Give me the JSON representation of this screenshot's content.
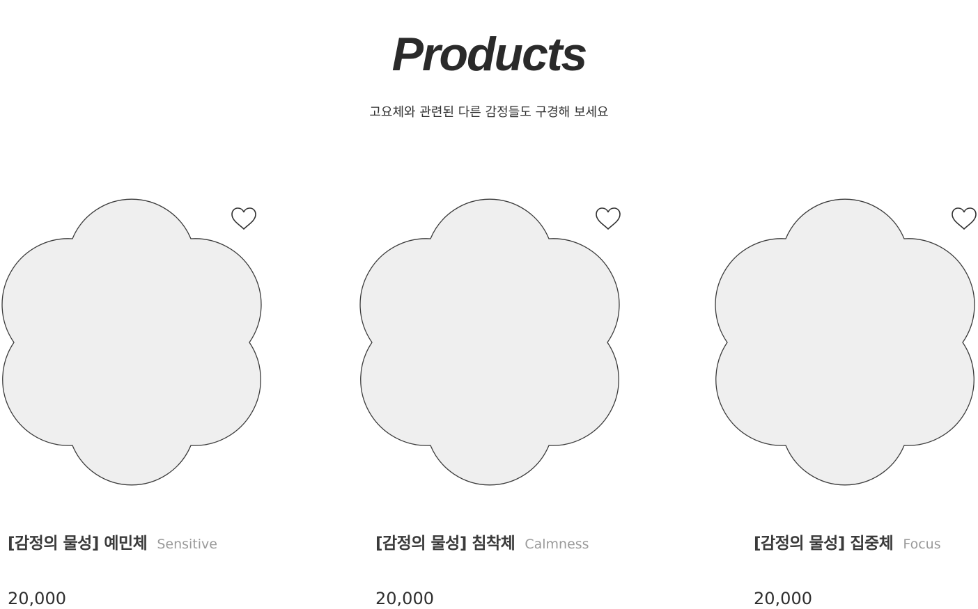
{
  "section": {
    "title": "Products",
    "subtitle": "고요체와 관련된 다른 감정들도 구경해 보세요"
  },
  "products": [
    {
      "name": "[감정의 물성] 예민체",
      "english": "Sensitive",
      "price": "20,000"
    },
    {
      "name": "[감정의 물성] 침착체",
      "english": "Calmness",
      "price": "20,000"
    },
    {
      "name": "[감정의 물성] 집중체",
      "english": "Focus",
      "price": "20,000"
    }
  ],
  "icons": {
    "wishlist": "heart-outline-icon"
  },
  "colors": {
    "blob_fill": "#efefef",
    "blob_stroke": "#3a3a3a",
    "text_main": "#2b2b2b",
    "text_muted": "#9a9a9a"
  }
}
